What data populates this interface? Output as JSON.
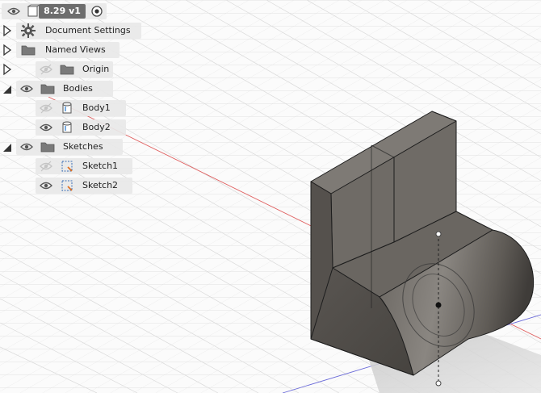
{
  "document": {
    "version": "8.29 v1"
  },
  "browser": {
    "items": [
      {
        "label": "Document Settings",
        "icon": "gear-icon",
        "visible": null,
        "expander": "collapsed"
      },
      {
        "label": "Named Views",
        "icon": "folder-icon",
        "visible": null,
        "expander": "collapsed"
      },
      {
        "label": "Origin",
        "icon": "folder-icon",
        "visible": false,
        "expander": "collapsed"
      },
      {
        "label": "Bodies",
        "icon": "folder-icon",
        "visible": true,
        "expander": "expanded"
      },
      {
        "label": "Body1",
        "icon": "body-icon",
        "visible": false,
        "expander": null
      },
      {
        "label": "Body2",
        "icon": "body-icon",
        "visible": true,
        "expander": null
      },
      {
        "label": "Sketches",
        "icon": "folder-icon",
        "visible": true,
        "expander": "expanded"
      },
      {
        "label": "Sketch1",
        "icon": "sketch-icon",
        "visible": false,
        "expander": null
      },
      {
        "label": "Sketch2",
        "icon": "sketch-icon",
        "visible": true,
        "expander": null
      }
    ]
  },
  "colors": {
    "body_face_light": "#6f6b66",
    "body_face_dark": "#4f4b47",
    "edge": "#1d1d1d",
    "grid": "#d9d9d9",
    "axis_x": "#e06060",
    "axis_z": "#6a6ad8"
  }
}
